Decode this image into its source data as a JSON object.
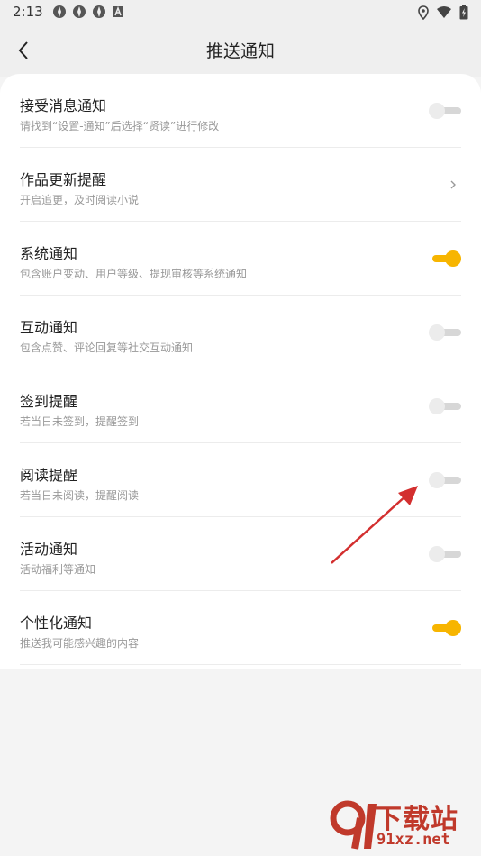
{
  "status_bar": {
    "time": "2:13",
    "left_icons": [
      "app-notification-icon",
      "app-notification-icon",
      "app-notification-icon",
      "a-icon"
    ],
    "right_icons": [
      "location-icon",
      "wifi-icon",
      "battery-icon"
    ]
  },
  "header": {
    "title": "推送通知",
    "back_icon": "chevron-left-icon"
  },
  "settings": [
    {
      "title": "接受消息通知",
      "subtitle": "请找到“设置-通知”后选择“贤读”进行修改",
      "control": "toggle",
      "on": false
    },
    {
      "title": "作品更新提醒",
      "subtitle": "开启追更，及时阅读小说",
      "control": "chevron"
    },
    {
      "title": "系统通知",
      "subtitle": "包含账户变动、用户等级、提现审核等系统通知",
      "control": "toggle",
      "on": true
    },
    {
      "title": "互动通知",
      "subtitle": "包含点赞、评论回复等社交互动通知",
      "control": "toggle",
      "on": false
    },
    {
      "title": "签到提醒",
      "subtitle": "若当日未签到，提醒签到",
      "control": "toggle",
      "on": false
    },
    {
      "title": "阅读提醒",
      "subtitle": "若当日未阅读，提醒阅读",
      "control": "toggle",
      "on": false
    },
    {
      "title": "活动通知",
      "subtitle": "活动福利等通知",
      "control": "toggle",
      "on": false
    },
    {
      "title": "个性化通知",
      "subtitle": "推送我可能感兴趣的内容",
      "control": "toggle",
      "on": true
    }
  ],
  "colors": {
    "accent": "#f7b500",
    "annotation_arrow": "#d32f2f"
  },
  "watermark": {
    "brand": "下载站",
    "url": "91xz.net"
  }
}
